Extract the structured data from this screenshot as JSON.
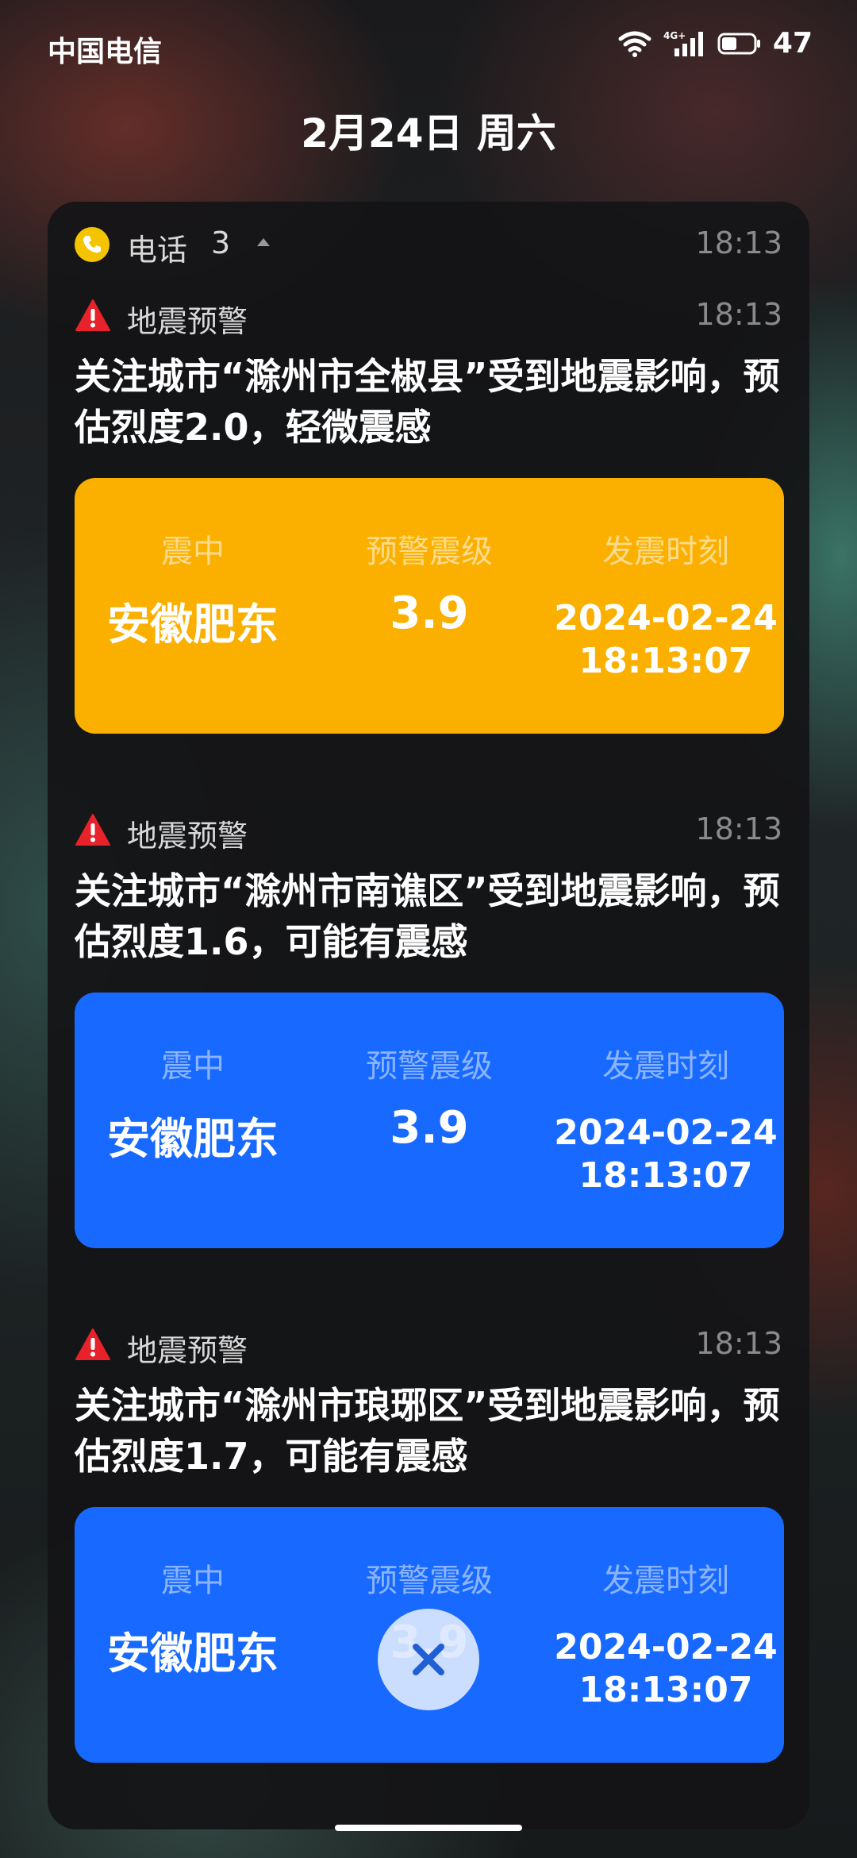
{
  "status_bar": {
    "carrier": "中国电信",
    "network": "4G+",
    "battery": "47"
  },
  "date": "2月24日 周六",
  "group": {
    "app": "电话",
    "count": "3",
    "time": "18:13"
  },
  "notifications": [
    {
      "app": "地震预警",
      "time": "18:13",
      "message": "关注城市“滁州市全椒县”受到地震影响，预估烈度2.0，轻微震感",
      "card_color": "#fbb000",
      "epicenter_label": "震中",
      "epicenter": "安徽肥东",
      "magnitude_label": "预警震级",
      "magnitude": "3.9",
      "time_label": "发震时刻",
      "quake_date": "2024-02-24",
      "quake_time": "18:13:07"
    },
    {
      "app": "地震预警",
      "time": "18:13",
      "message": "关注城市“滁州市南谯区”受到地震影响，预估烈度1.6，可能有震感",
      "card_color": "#1769ff",
      "epicenter_label": "震中",
      "epicenter": "安徽肥东",
      "magnitude_label": "预警震级",
      "magnitude": "3.9",
      "time_label": "发震时刻",
      "quake_date": "2024-02-24",
      "quake_time": "18:13:07"
    },
    {
      "app": "地震预警",
      "time": "18:13",
      "message": "关注城市“滁州市琅琊区”受到地震影响，预估烈度1.7，可能有震感",
      "card_color": "#1769ff",
      "epicenter_label": "震中",
      "epicenter": "安徽肥东",
      "magnitude_label": "预警震级",
      "magnitude": "3.9",
      "time_label": "发震时刻",
      "quake_date": "2024-02-24",
      "quake_time": "18:13:07"
    }
  ],
  "icons": {
    "phone": "phone-icon",
    "warning": "warning-triangle-icon",
    "dismiss": "close-icon"
  },
  "colors": {
    "warning_red": "#e8222a",
    "phone_yellow": "#f5c400"
  }
}
